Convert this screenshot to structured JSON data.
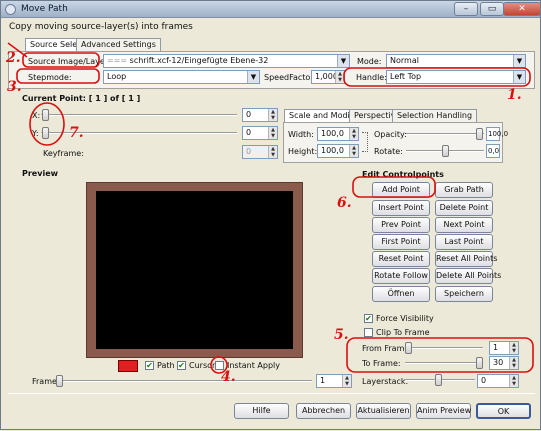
{
  "window": {
    "title": "Move Path",
    "min": "–",
    "max": "▭",
    "close": "✕"
  },
  "heading": "Copy moving source-layer(s) into frames",
  "tabs": {
    "source_select": "Source Select",
    "advanced": "Advanced Settings"
  },
  "source": {
    "label": "Source Image/Layer:",
    "value": "schrift.xcf-12/Eingefügte Ebene-32",
    "mode_label": "Mode:",
    "mode_value": "Normal"
  },
  "stepmode": {
    "label": "Stepmode:",
    "value": "Loop",
    "speed_label": "SpeedFactor:",
    "speed_value": "1,000",
    "handle_label": "Handle:",
    "handle_value": "Left  Top"
  },
  "current_point": {
    "label": "Current Point: [   1 ] of [   1 ]"
  },
  "xy": {
    "x_label": "X:",
    "x_value": "0",
    "y_label": "Y:",
    "y_value": "0",
    "keyframe_label": "Keyframe:",
    "keyframe_value": "0"
  },
  "scale_tabs": {
    "scale_modify": "Scale and Modify",
    "perspective": "Perspective",
    "selection": "Selection Handling"
  },
  "scale": {
    "width_label": "Width:",
    "width_value": "100,0",
    "height_label": "Height:",
    "height_value": "100,0",
    "opacity_label": "Opacity:",
    "opacity_value": "100,0",
    "rotate_label": "Rotate:",
    "rotate_value": "0,0"
  },
  "preview": {
    "label": "Preview",
    "path_label": "Path",
    "cursor_label": "Cursor",
    "instant_label": "Instant Apply",
    "frame_label": "Frame:",
    "frame_value": "1"
  },
  "edit": {
    "title": "Edit Controlpoints",
    "buttons": [
      [
        "Add Point",
        "Grab Path"
      ],
      [
        "Insert Point",
        "Delete Point"
      ],
      [
        "Prev Point",
        "Next Point"
      ],
      [
        "First Point",
        "Last Point"
      ],
      [
        "Reset Point",
        "Reset All Points"
      ],
      [
        "Rotate Follow",
        "Delete All Points"
      ],
      [
        "Öffnen",
        "Speichern"
      ]
    ]
  },
  "options": {
    "force_visibility": "Force Visibility",
    "clip_to_frame": "Clip To Frame",
    "from_frame_label": "From Frame:",
    "from_frame_value": "1",
    "to_frame_label": "To Frame:",
    "to_frame_value": "30",
    "layerstack_label": "Layerstack:",
    "layerstack_value": "0"
  },
  "footer": {
    "help": "Hilfe",
    "cancel": "Abbrechen",
    "refresh": "Aktualisieren",
    "anim_preview": "Anim Preview",
    "ok": "OK"
  },
  "annotations": {
    "n1": "1.",
    "n2": "2.",
    "n3": "3.",
    "n4": "4.",
    "n5": "5.",
    "n6": "6.",
    "n7": "7."
  },
  "annotation_color": "#d91010"
}
